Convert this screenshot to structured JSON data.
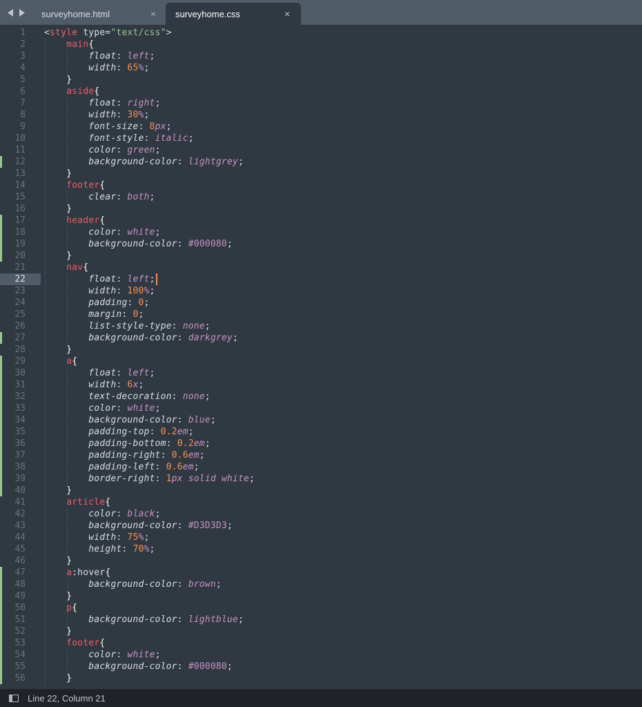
{
  "tabs": [
    {
      "label": "surveyhome.html",
      "active": false
    },
    {
      "label": "surveyhome.css",
      "active": true
    }
  ],
  "status": {
    "position": "Line 22, Column 21"
  },
  "active_line": 22,
  "colors": {
    "background": "#303841",
    "tabbar": "#4f5b66",
    "gutter_mark": "#99c794",
    "caret": "#f99157"
  },
  "lines": [
    {
      "n": 1,
      "text": "<style type=\"text/css\">",
      "mark": false
    },
    {
      "n": 2,
      "text": "    main{",
      "mark": false
    },
    {
      "n": 3,
      "text": "        float: left;",
      "mark": false
    },
    {
      "n": 4,
      "text": "        width: 65%;",
      "mark": false
    },
    {
      "n": 5,
      "text": "    }",
      "mark": false
    },
    {
      "n": 6,
      "text": "    aside{",
      "mark": false
    },
    {
      "n": 7,
      "text": "        float: right;",
      "mark": false
    },
    {
      "n": 8,
      "text": "        width: 30%;",
      "mark": false
    },
    {
      "n": 9,
      "text": "        font-size: 8px;",
      "mark": false
    },
    {
      "n": 10,
      "text": "        font-style: italic;",
      "mark": false
    },
    {
      "n": 11,
      "text": "        color: green;",
      "mark": false
    },
    {
      "n": 12,
      "text": "        background-color: lightgrey;",
      "mark": true
    },
    {
      "n": 13,
      "text": "    }",
      "mark": false
    },
    {
      "n": 14,
      "text": "    footer{",
      "mark": false
    },
    {
      "n": 15,
      "text": "        clear: both;",
      "mark": false
    },
    {
      "n": 16,
      "text": "    }",
      "mark": false
    },
    {
      "n": 17,
      "text": "    header{",
      "mark": true
    },
    {
      "n": 18,
      "text": "        color: white;",
      "mark": true
    },
    {
      "n": 19,
      "text": "        background-color: #000080;",
      "mark": true
    },
    {
      "n": 20,
      "text": "    }",
      "mark": true
    },
    {
      "n": 21,
      "text": "    nav{",
      "mark": false
    },
    {
      "n": 22,
      "text": "        float: left;",
      "mark": false,
      "caret": true
    },
    {
      "n": 23,
      "text": "        width: 100%;",
      "mark": false
    },
    {
      "n": 24,
      "text": "        padding: 0;",
      "mark": false
    },
    {
      "n": 25,
      "text": "        margin: 0;",
      "mark": false
    },
    {
      "n": 26,
      "text": "        list-style-type: none;",
      "mark": false
    },
    {
      "n": 27,
      "text": "        background-color: darkgrey;",
      "mark": true
    },
    {
      "n": 28,
      "text": "    }",
      "mark": false
    },
    {
      "n": 29,
      "text": "    a{",
      "mark": true
    },
    {
      "n": 30,
      "text": "        float: left;",
      "mark": true
    },
    {
      "n": 31,
      "text": "        width: 6x;",
      "mark": true
    },
    {
      "n": 32,
      "text": "        text-decoration: none;",
      "mark": true
    },
    {
      "n": 33,
      "text": "        color: white;",
      "mark": true
    },
    {
      "n": 34,
      "text": "        background-color: blue;",
      "mark": true
    },
    {
      "n": 35,
      "text": "        padding-top: 0.2em;",
      "mark": true
    },
    {
      "n": 36,
      "text": "        padding-bottom: 0.2em;",
      "mark": true
    },
    {
      "n": 37,
      "text": "        padding-right: 0.6em;",
      "mark": true
    },
    {
      "n": 38,
      "text": "        padding-left: 0.6em;",
      "mark": true
    },
    {
      "n": 39,
      "text": "        border-right: 1px solid white;",
      "mark": true
    },
    {
      "n": 40,
      "text": "    }",
      "mark": true
    },
    {
      "n": 41,
      "text": "    article{",
      "mark": false
    },
    {
      "n": 42,
      "text": "        color: black;",
      "mark": false
    },
    {
      "n": 43,
      "text": "        background-color: #D3D3D3;",
      "mark": false
    },
    {
      "n": 44,
      "text": "        width: 75%;",
      "mark": false
    },
    {
      "n": 45,
      "text": "        height: 70%;",
      "mark": false
    },
    {
      "n": 46,
      "text": "    }",
      "mark": false
    },
    {
      "n": 47,
      "text": "    a:hover{",
      "mark": true
    },
    {
      "n": 48,
      "text": "        background-color: brown;",
      "mark": true
    },
    {
      "n": 49,
      "text": "    }",
      "mark": true
    },
    {
      "n": 50,
      "text": "    p{",
      "mark": true
    },
    {
      "n": 51,
      "text": "        background-color: lightblue;",
      "mark": true
    },
    {
      "n": 52,
      "text": "    }",
      "mark": true
    },
    {
      "n": 53,
      "text": "    footer{",
      "mark": true
    },
    {
      "n": 54,
      "text": "        color: white;",
      "mark": true
    },
    {
      "n": 55,
      "text": "        background-color: #000080;",
      "mark": true
    },
    {
      "n": 56,
      "text": "    }",
      "mark": true
    }
  ]
}
